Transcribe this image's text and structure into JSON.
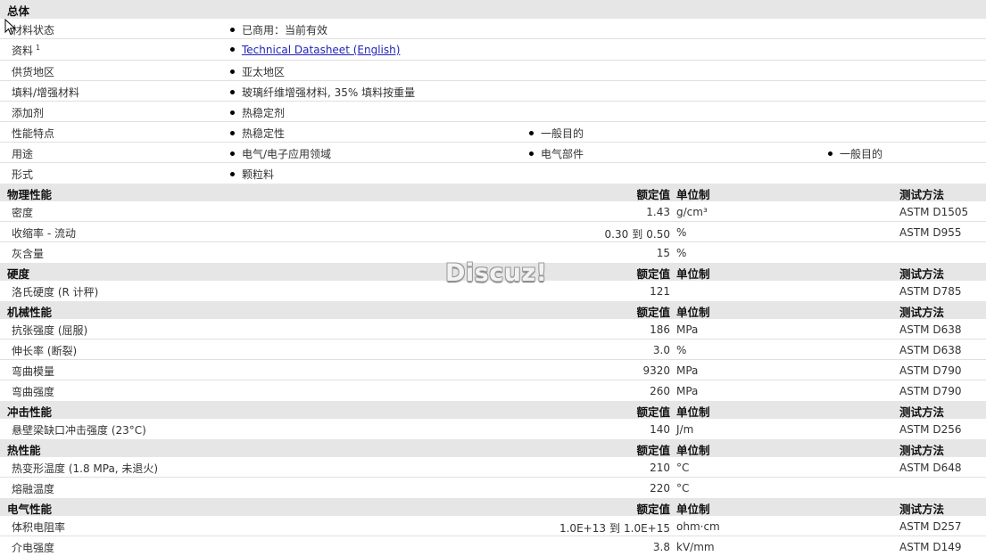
{
  "general": {
    "title": "总体",
    "status_label": "材料状态",
    "status_value": "已商用：当前有效",
    "docs_label": "资料",
    "docs_sup": "1",
    "docs_link": "Technical Datasheet (English)",
    "region_label": "供货地区",
    "region_value": "亚太地区",
    "filler_label": "填料/增强材料",
    "filler_value": "玻璃纤维增强材料, 35% 填料按重量",
    "additive_label": "添加剂",
    "additive_value": "热稳定剂",
    "features_label": "性能特点",
    "features": [
      "热稳定性",
      "一般目的"
    ],
    "uses_label": "用途",
    "uses": [
      "电气/电子应用领域",
      "电气部件",
      "一般目的"
    ],
    "form_label": "形式",
    "form_value": "颗粒料"
  },
  "headers": {
    "nominal": "额定值",
    "unit": "单位制",
    "method": "测试方法"
  },
  "physical": {
    "title": "物理性能",
    "density_label": "密度",
    "density_value": "1.43",
    "density_unit": "g/cm³",
    "density_method": "ASTM D1505",
    "shrink_label": "收缩率  - 流动",
    "shrink_min": "0.30",
    "shrink_to": "到",
    "shrink_max": "0.50",
    "shrink_unit": "%",
    "shrink_method": "ASTM D955",
    "ash_label": "灰含量",
    "ash_value": "15",
    "ash_unit": "%"
  },
  "hardness": {
    "title": "硬度",
    "rockwell_label": "洛氏硬度  (R 计秤)",
    "rockwell_value": "121",
    "rockwell_method": "ASTM D785"
  },
  "mechanical": {
    "title": "机械性能",
    "tensile_label": "抗张强度  (屈服)",
    "tensile_value": "186",
    "tensile_unit": "MPa",
    "tensile_method": "ASTM D638",
    "elong_label": "伸长率  (断裂)",
    "elong_value": "3.0",
    "elong_unit": "%",
    "elong_method": "ASTM D638",
    "flexmod_label": "弯曲模量",
    "flexmod_value": "9320",
    "flexmod_unit": "MPa",
    "flexmod_method": "ASTM D790",
    "flexstr_label": "弯曲强度",
    "flexstr_value": "260",
    "flexstr_unit": "MPa",
    "flexstr_method": "ASTM D790"
  },
  "impact": {
    "title": "冲击性能",
    "izod_label": "悬壁梁缺口冲击强度  (23°C)",
    "izod_value": "140",
    "izod_unit": "J/m",
    "izod_method": "ASTM D256"
  },
  "thermal": {
    "title": "热性能",
    "hdt_label": "热变形温度  (1.8 MPa, 未退火)",
    "hdt_value": "210",
    "hdt_unit": "°C",
    "hdt_method": "ASTM D648",
    "melt_label": "熔融温度",
    "melt_value": "220",
    "melt_unit": "°C"
  },
  "electrical": {
    "title": "电气性能",
    "vr_label": "体积电阻率",
    "vr_min": "1.0E+13",
    "vr_to": "到",
    "vr_max": "1.0E+15",
    "vr_unit": "ohm·cm",
    "vr_method": "ASTM D257",
    "ds_label": "介电强度",
    "ds_value": "3.8",
    "ds_unit": "kV/mm",
    "ds_method": "ASTM D149"
  },
  "watermark": "Discuz!",
  "colors": {
    "section_bg": "#e6e6e6",
    "link": "#2222bb",
    "row_border": "#e0e0e0"
  }
}
